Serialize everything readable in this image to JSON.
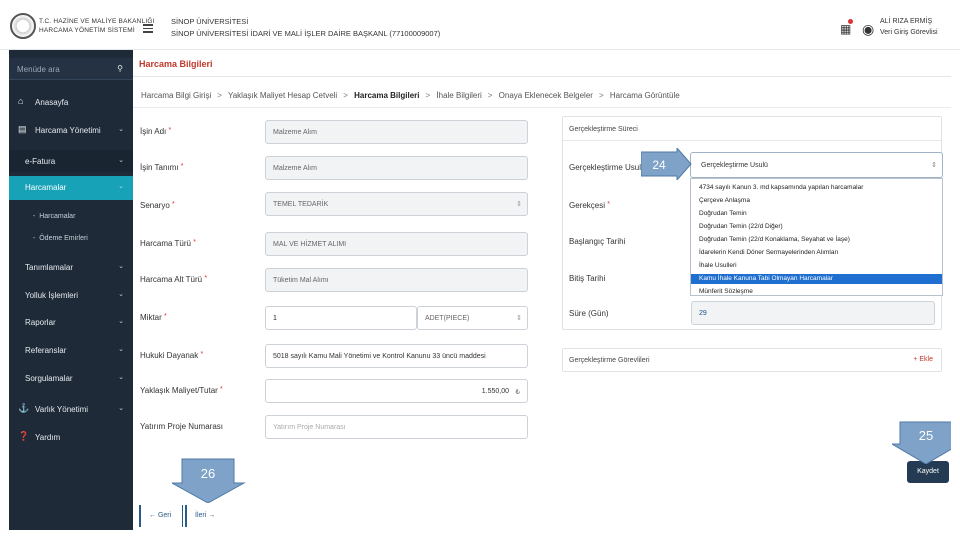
{
  "header": {
    "brand_line1": "T.C. HAZİNE VE MALİYE BAKANLIĞI",
    "brand_line2": "HARCAMA YÖNETİM SİSTEMİ",
    "org_line1": "SİNOP ÜNİVERSİTESİ",
    "org_line2": "SİNOP ÜNİVERSİTESİ İDARİ VE MALİ İŞLER DAİRE BAŞKANL (77100009007)",
    "user_name": "ALİ RIZA ERMİŞ",
    "user_role": "Veri Giriş Görevlisi"
  },
  "sidebar": {
    "search_placeholder": "Menüde ara",
    "items": [
      {
        "label": "Anasayfa",
        "icon": "home-icon"
      },
      {
        "label": "Harcama Yönetimi",
        "icon": "card-icon"
      },
      {
        "label": "e-Fatura"
      },
      {
        "label": "Harcamalar"
      },
      {
        "label": "Tanımlamalar"
      },
      {
        "label": "Yolluk İşlemleri"
      },
      {
        "label": "Raporlar"
      },
      {
        "label": "Referanslar"
      },
      {
        "label": "Sorgulamalar"
      },
      {
        "label": "Varlık Yönetimi",
        "icon": "bank-icon"
      },
      {
        "label": "Yardım",
        "icon": "help-icon"
      }
    ],
    "subitems": [
      "Harcamalar",
      "Ödeme Emirleri"
    ],
    "sub_bullet": "-"
  },
  "page": {
    "title": "Harcama Bilgileri",
    "breadcrumbs": [
      "Harcama Bilgi Girişi",
      "Yaklaşık Maliyet Hesap Cetveli",
      "Harcama Bilgileri",
      "İhale Bilgileri",
      "Onaya Eklenecek Belgeler",
      "Harcama Görüntüle"
    ],
    "breadcrumb_separator": ">",
    "required_mark": "*"
  },
  "form": {
    "is_adi": {
      "label": "İşin Adı",
      "value": "Malzeme Alım"
    },
    "is_tanimi": {
      "label": "İşin Tanımı",
      "value": "Malzeme Alım"
    },
    "senaryo": {
      "label": "Senaryo",
      "value": "TEMEL TEDARİK"
    },
    "harcama_turu": {
      "label": "Harcama Türü",
      "value": "MAL VE HİZMET ALIMI"
    },
    "harcama_alt_turu": {
      "label": "Harcama Alt Türü",
      "value": "Tüketim Mal Alımı"
    },
    "miktar": {
      "label": "Miktar",
      "value": "1",
      "unit": "ADET(PIECE)"
    },
    "hukuki_dayanak": {
      "label": "Hukuki Dayanak",
      "value": "5018 sayılı Kamu Mali Yönetimi ve Kontrol Kanunu 33 üncü maddesi"
    },
    "yaklasik_maliyet": {
      "label": "Yaklaşık Maliyet/Tutar",
      "value": "1.550,00",
      "currency": "₺"
    },
    "yatirim_proje": {
      "label": "Yatırım Proje Numarası",
      "placeholder": "Yatırım Proje Numarası"
    }
  },
  "gerceklestirme": {
    "panel_title": "Gerçekleştirme Süreci",
    "usul_label": "Gerçekleştirme Usulü",
    "usul_value": "Gerçekleştirme Usulü",
    "gerekce_label": "Gerekçesi",
    "baslangic_label": "Başlangıç Tarihi",
    "bitis_label": "Bitiş Tarihi",
    "sure_label": "Süre (Gün)",
    "sure_value": "29",
    "options": [
      "4734 sayılı Kanun 3. md kapsamında yapılan harcamalar",
      "Çerçeve Anlaşma",
      "Doğrudan Temin",
      "Doğrudan Temin (22/d Diğer)",
      "Doğrudan Temin (22/d Konaklama, Seyahat ve İaşe)",
      "İdarelerin Kendi Döner Sermayelerinden Alımları",
      "İhale Usulleri",
      "Kamu İhale Kanuna Tabi Olmayan Harcamalar",
      "Münferit Sözleşme"
    ],
    "selected_option_index": 7,
    "gorevliler_title": "Gerçekleştirme Görevlileri",
    "add_label": "+ Ekle"
  },
  "actions": {
    "save_label": "Kaydet",
    "back_label": "← Geri",
    "next_label": "İleri →"
  },
  "callouts": {
    "c24": "24",
    "c25": "25",
    "c26": "26"
  },
  "colors": {
    "sidebar_bg": "#1e2a38",
    "sidebar_active": "#17a2b8",
    "title_red": "#c0392b",
    "save_btn": "#243b53",
    "callout_fill": "#7ea2c8",
    "selected_option": "#1e6fd0"
  }
}
